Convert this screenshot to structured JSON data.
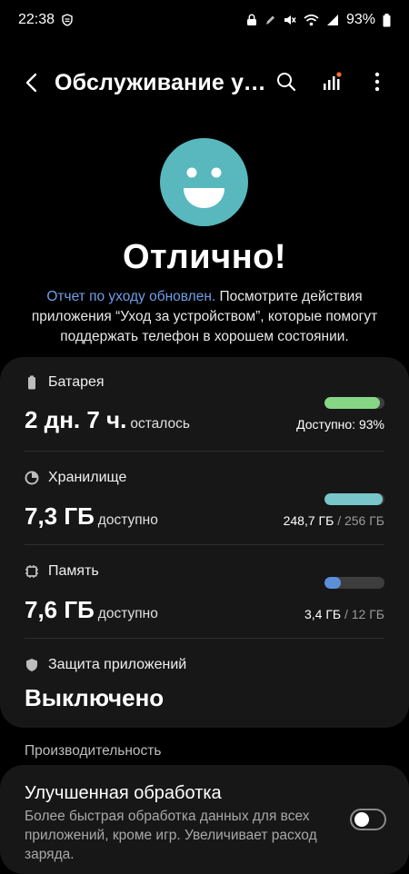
{
  "status_bar": {
    "time": "22:38",
    "battery_percent": "93%",
    "icons": [
      "shield-notification-icon",
      "lock-icon",
      "pen-icon",
      "mute-icon",
      "wifi-icon",
      "signal-icon",
      "battery-icon"
    ]
  },
  "header": {
    "back_icon": "back-arrow-icon",
    "title": "Обслуживание устройства",
    "actions": [
      "search-icon",
      "bar-chart-icon",
      "more-icon"
    ]
  },
  "hero": {
    "status_icon": "smiley-face-icon",
    "headline": "Отлично!",
    "report_link": "Отчет по уходу обновлен.",
    "report_text": " Посмотрите действия приложения “Уход за устройством”, которые помогут поддержать телефон в хорошем состоянии."
  },
  "sections": {
    "battery": {
      "icon": "battery-icon",
      "label": "Батарея",
      "value": "2 дн. 7 ч.",
      "unit": "осталось",
      "caption": "Доступно: 93%",
      "fill": 0.93,
      "color": "#86d686"
    },
    "storage": {
      "icon": "pie-chart-icon",
      "label": "Хранилище",
      "value": "7,3 ГБ",
      "unit": "доступно",
      "used": "248,7 ГБ",
      "total": "/ 256 ГБ",
      "fill": 0.97,
      "color": "#78c6c9"
    },
    "memory": {
      "icon": "chip-icon",
      "label": "Память",
      "value": "7,6 ГБ",
      "unit": "доступно",
      "used": "3,4 ГБ",
      "total": "/ 12 ГБ",
      "fill": 0.28,
      "color": "#5b8fd8"
    },
    "app_protection": {
      "icon": "shield-icon",
      "label": "Защита приложений",
      "value": "Выключено"
    }
  },
  "performance": {
    "section_label": "Производительность",
    "title": "Улучшенная обработка",
    "description": "Более быстрая обработка данных для всех приложений, кроме игр. Увеличивает расход заряда.",
    "toggle_on": false
  }
}
